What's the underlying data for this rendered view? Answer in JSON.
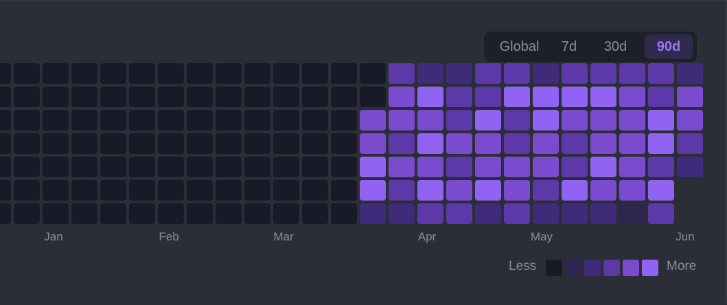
{
  "range_tabs": [
    {
      "label": "Global",
      "active": false
    },
    {
      "label": "7d",
      "active": false
    },
    {
      "label": "30d",
      "active": false
    },
    {
      "label": "90d",
      "active": true
    }
  ],
  "levels": [
    "#181a27",
    "#2f2650",
    "#3f2b7a",
    "#5c38a8",
    "#7a4acf",
    "#9063f2"
  ],
  "months": [
    "Jan",
    "Feb",
    "Mar",
    "Apr",
    "May",
    "Jun"
  ],
  "legend": {
    "less": "Less",
    "more": "More"
  },
  "activity_rows": [
    [
      0,
      0,
      0,
      0,
      0,
      0,
      0,
      0,
      0,
      0,
      0,
      0,
      0,
      0,
      3,
      2,
      2,
      3,
      3,
      2,
      3,
      3,
      3,
      3,
      2
    ],
    [
      0,
      0,
      0,
      0,
      0,
      0,
      0,
      0,
      0,
      0,
      0,
      0,
      0,
      0,
      4,
      5,
      3,
      3,
      5,
      5,
      5,
      5,
      4,
      3,
      4
    ],
    [
      0,
      0,
      0,
      0,
      0,
      0,
      0,
      0,
      0,
      0,
      0,
      0,
      0,
      4,
      4,
      4,
      3,
      5,
      3,
      5,
      4,
      4,
      4,
      5,
      4
    ],
    [
      0,
      0,
      0,
      0,
      0,
      0,
      0,
      0,
      0,
      0,
      0,
      0,
      0,
      4,
      3,
      5,
      4,
      4,
      3,
      4,
      3,
      4,
      4,
      5,
      3
    ],
    [
      0,
      0,
      0,
      0,
      0,
      0,
      0,
      0,
      0,
      0,
      0,
      0,
      0,
      5,
      4,
      4,
      3,
      4,
      4,
      4,
      3,
      5,
      4,
      3,
      2
    ],
    [
      0,
      0,
      0,
      0,
      0,
      0,
      0,
      0,
      0,
      0,
      0,
      0,
      0,
      5,
      3,
      5,
      4,
      5,
      4,
      3,
      5,
      4,
      4,
      5,
      null
    ],
    [
      0,
      0,
      0,
      0,
      0,
      0,
      0,
      0,
      0,
      0,
      0,
      0,
      0,
      2,
      2,
      3,
      3,
      2,
      3,
      2,
      2,
      2,
      1,
      3,
      null
    ]
  ]
}
